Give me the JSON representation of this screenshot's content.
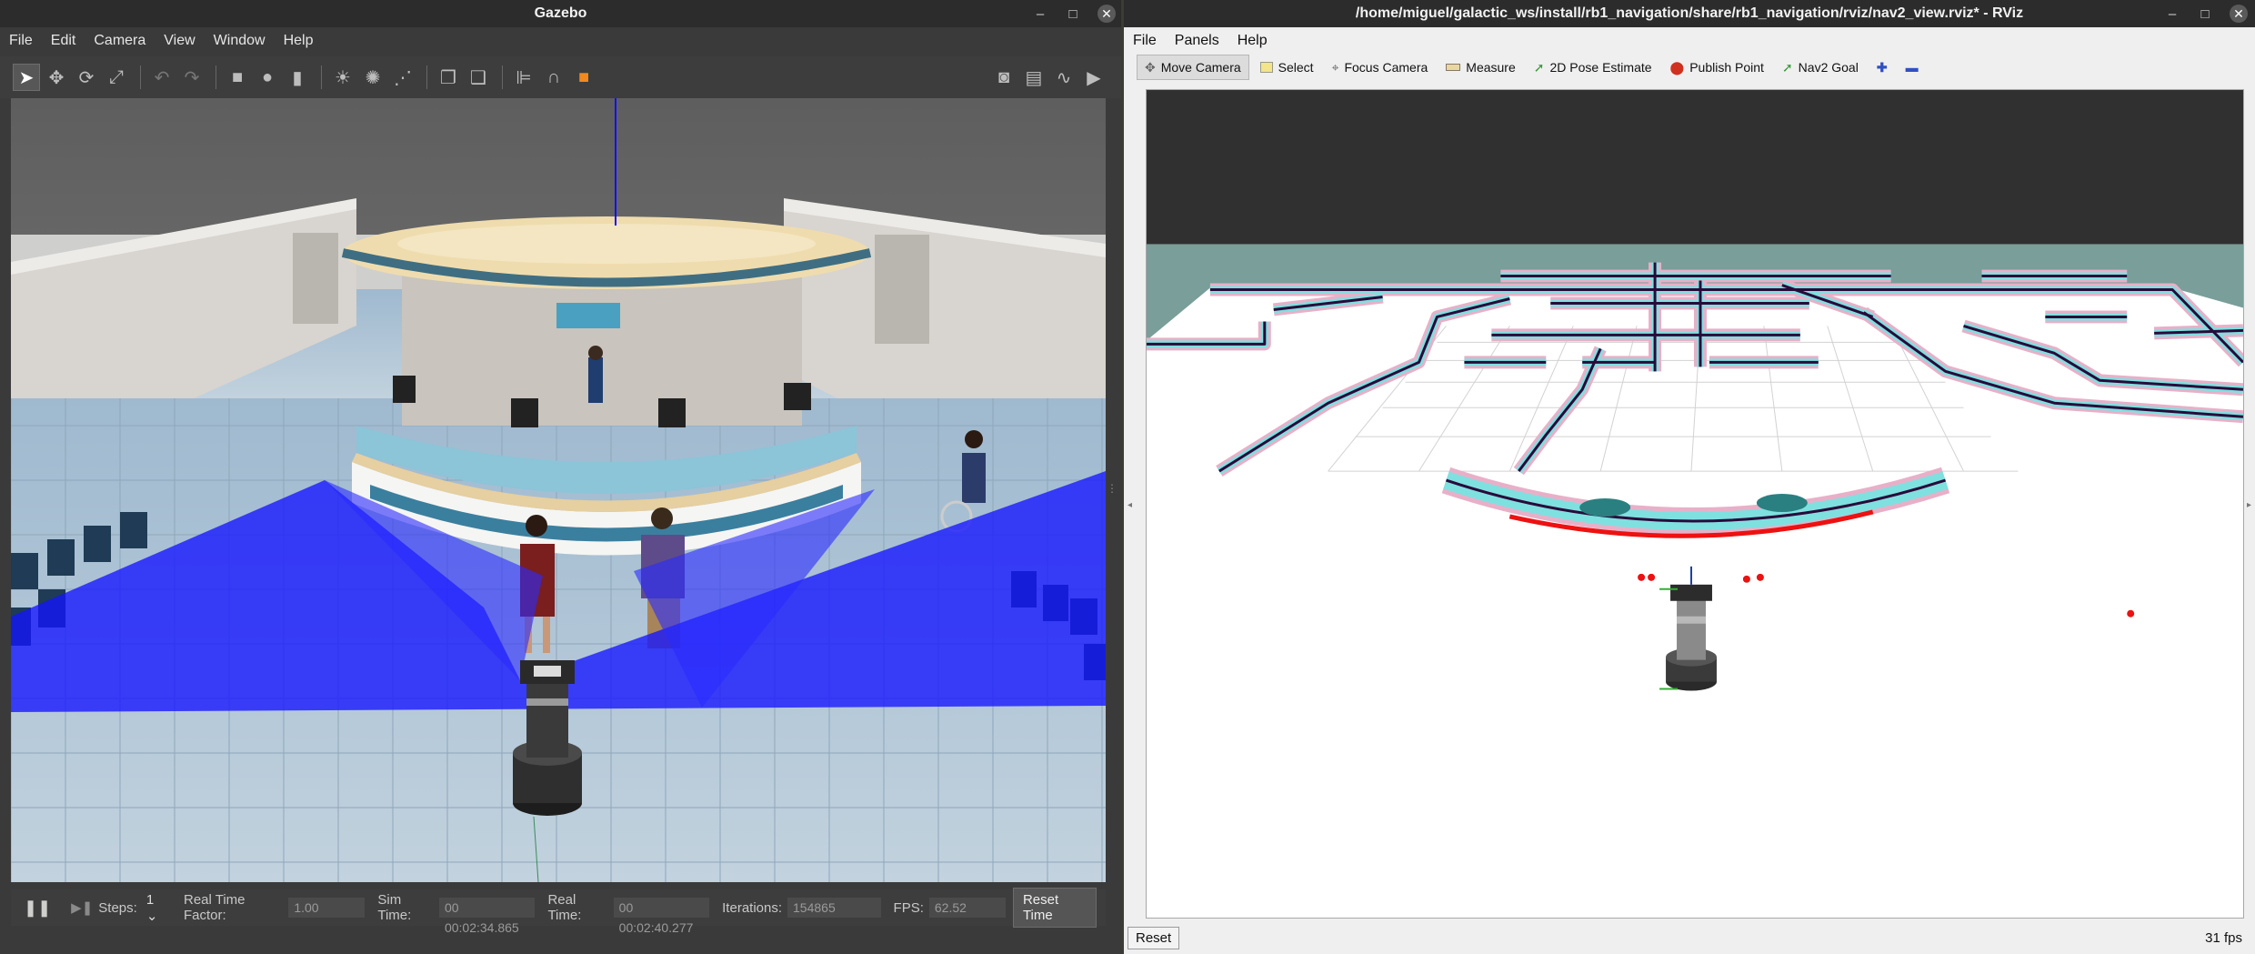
{
  "gazebo": {
    "title": "Gazebo",
    "menu": [
      "File",
      "Edit",
      "Camera",
      "View",
      "Window",
      "Help"
    ],
    "toolbar_icons": [
      "select-arrow-icon",
      "translate-icon",
      "rotate-icon",
      "scale-icon",
      "undo-icon",
      "redo-icon",
      "box-icon",
      "sphere-icon",
      "cylinder-icon",
      "sun-light-icon",
      "point-light-icon",
      "spot-light-icon",
      "copy-icon",
      "paste-icon",
      "align-icon",
      "snap-icon",
      "orange-view-icon",
      "camera-screenshot-icon",
      "log-icon",
      "plot-icon",
      "video-record-icon"
    ],
    "bottom": {
      "steps_label": "Steps:",
      "steps_value": "1",
      "rtf_label": "Real Time Factor:",
      "rtf_value": "1.00",
      "sim_label": "Sim Time:",
      "sim_value": "00 00:02:34.865",
      "real_label": "Real Time:",
      "real_value": "00 00:02:40.277",
      "iter_label": "Iterations:",
      "iter_value": "154865",
      "fps_label": "FPS:",
      "fps_value": "62.52",
      "reset_label": "Reset Time"
    }
  },
  "rviz": {
    "title": "/home/miguel/galactic_ws/install/rb1_navigation/share/rb1_navigation/rviz/nav2_view.rviz* - RViz",
    "menu": [
      "File",
      "Panels",
      "Help"
    ],
    "tools": [
      {
        "label": "Move Camera",
        "icon": "move-camera-icon"
      },
      {
        "label": "Select",
        "icon": "select-icon"
      },
      {
        "label": "Focus Camera",
        "icon": "focus-camera-icon"
      },
      {
        "label": "Measure",
        "icon": "measure-icon"
      },
      {
        "label": "2D Pose Estimate",
        "icon": "pose-estimate-arrow-icon"
      },
      {
        "label": "Publish Point",
        "icon": "publish-point-icon"
      },
      {
        "label": "Nav2 Goal",
        "icon": "nav2-goal-arrow-icon"
      }
    ],
    "reset_label": "Reset",
    "fps": "31 fps"
  },
  "colors": {
    "laser": "#1515ff",
    "map_wall": "#2a0a3a",
    "inflation_cyan": "#7fe0e0",
    "inflation_pink": "#e8b0c8",
    "scan_red": "#ee1111"
  }
}
